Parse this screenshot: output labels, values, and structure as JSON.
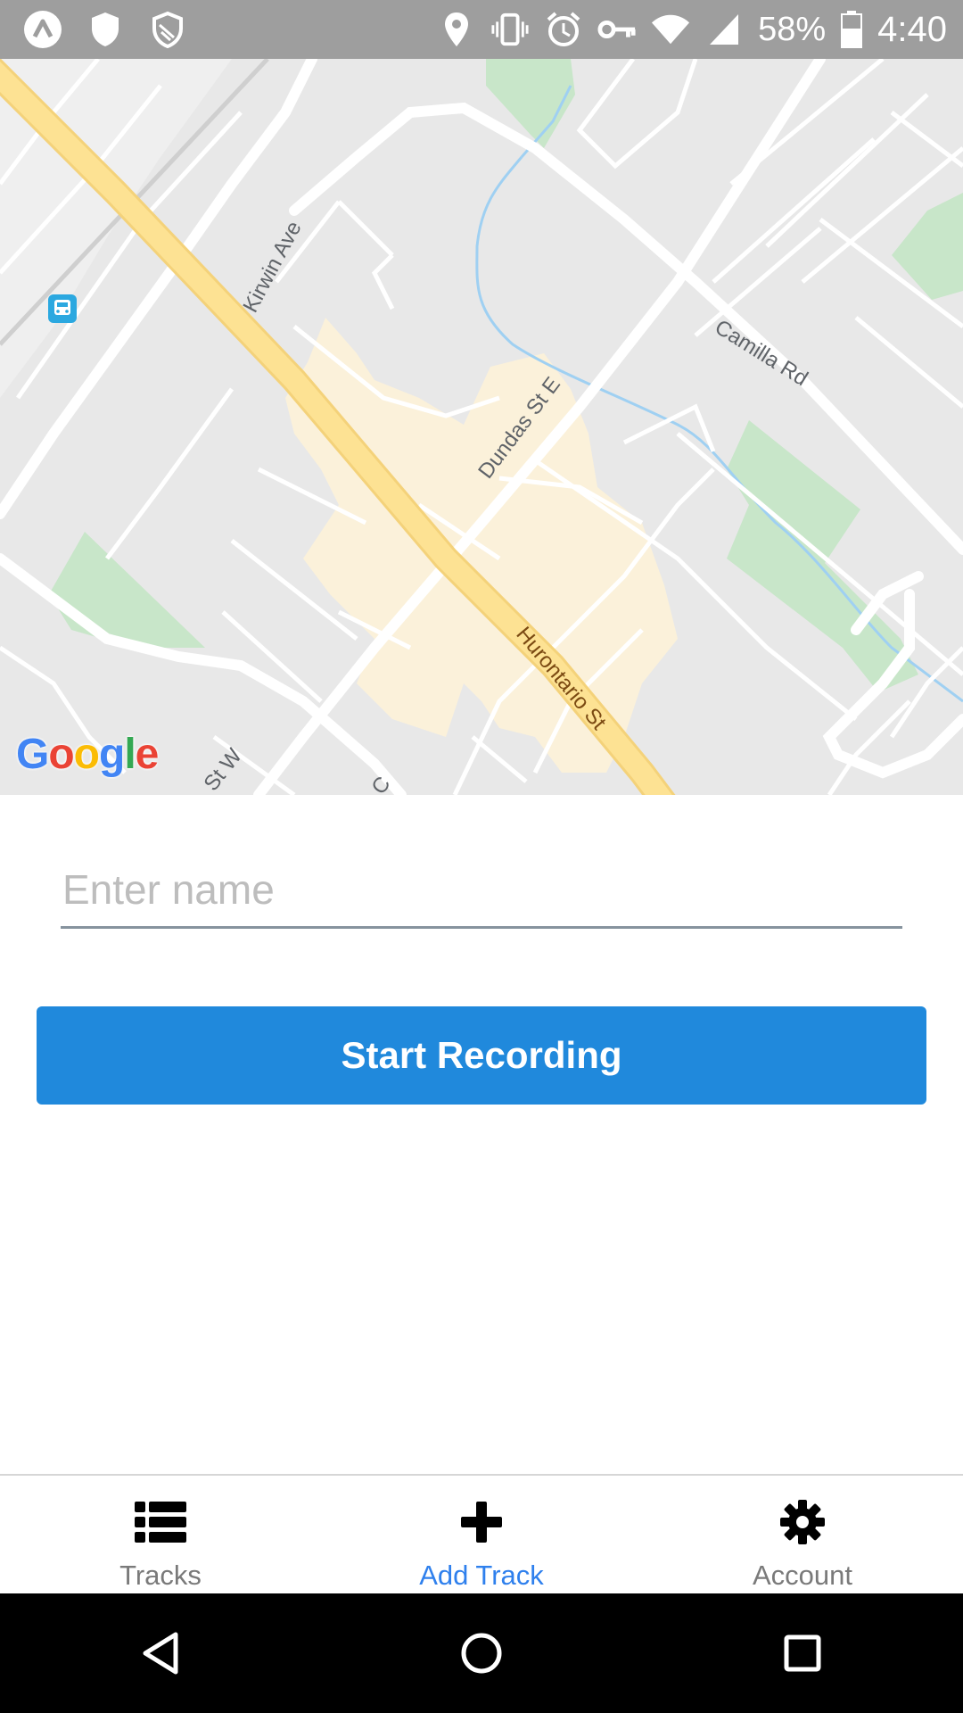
{
  "status_bar": {
    "battery": "58%",
    "time": "4:40",
    "icons": [
      "app-icon",
      "shield-icon",
      "shield-outline-icon",
      "location-icon",
      "vibrate-icon",
      "alarm-icon",
      "vpn-key-icon",
      "wifi-icon",
      "signal-icon",
      "battery-icon"
    ]
  },
  "map": {
    "logo": "Google",
    "street_labels": {
      "kirwin": "Kirwin Ave",
      "dundas": "Dundas St E",
      "camilla": "Camilla Rd",
      "hurontario": "Hurontario St",
      "st_w": "St W",
      "partial_c": "C"
    },
    "colors": {
      "background": "#e8e8e8",
      "road": "#ffffff",
      "highway": "#fde293",
      "park": "#c8e6c9",
      "urban_area": "#fbf1da",
      "water": "#9fd0f2",
      "transit": "#2ba8e0"
    }
  },
  "form": {
    "name_placeholder": "Enter name",
    "name_value": "",
    "start_button_label": "Start Recording",
    "button_color": "#2089dc"
  },
  "tabs": [
    {
      "label": "Tracks",
      "icon": "list-icon",
      "active": false
    },
    {
      "label": "Add Track",
      "icon": "plus-icon",
      "active": true
    },
    {
      "label": "Account",
      "icon": "gear-icon",
      "active": false
    }
  ],
  "nav_bar": {
    "icons": [
      "back-icon",
      "home-icon",
      "recents-icon"
    ]
  }
}
